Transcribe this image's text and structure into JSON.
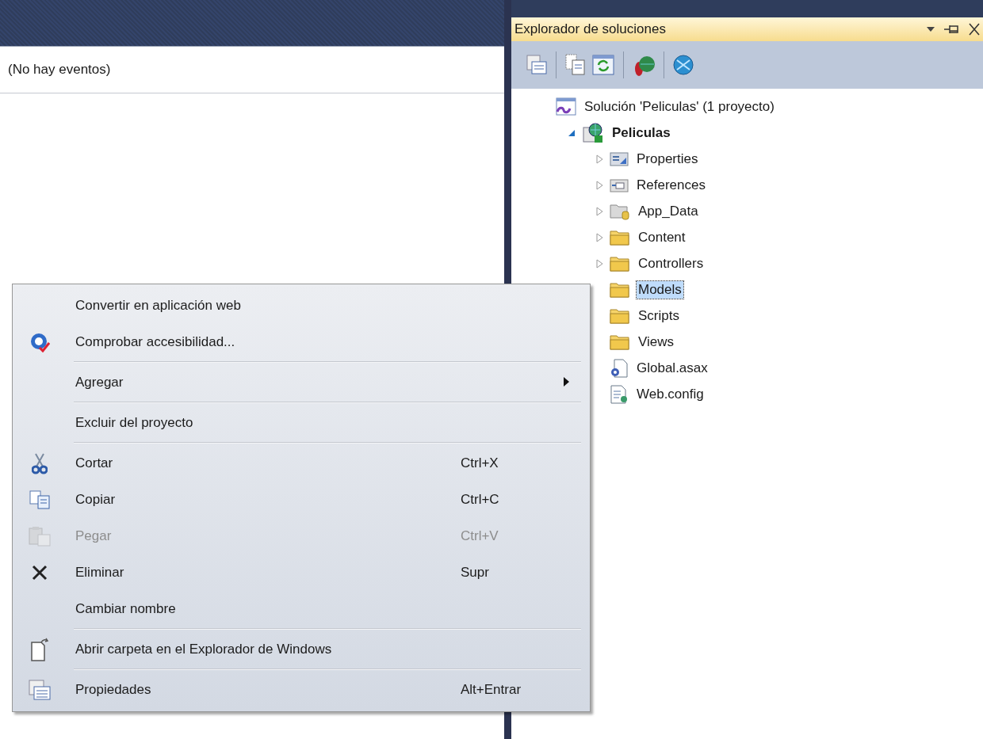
{
  "left_pane": {
    "event_dropdown": "(No hay eventos)"
  },
  "solution_explorer": {
    "title": "Explorador de soluciones",
    "tree": [
      {
        "label": "Solución 'Peliculas'  (1 proyecto)",
        "kind": "solution",
        "selected": false,
        "children": [
          {
            "label": "Peliculas",
            "kind": "project",
            "expanded": true,
            "selected": false,
            "children": [
              {
                "label": "Properties",
                "kind": "properties",
                "expanded": false,
                "selected": false
              },
              {
                "label": "References",
                "kind": "references",
                "expanded": false,
                "selected": false
              },
              {
                "label": "App_Data",
                "kind": "app-data",
                "expanded": false,
                "selected": false
              },
              {
                "label": "Content",
                "kind": "folder",
                "expanded": false,
                "selected": false
              },
              {
                "label": "Controllers",
                "kind": "folder",
                "expanded": false,
                "selected": false
              },
              {
                "label": "Models",
                "kind": "folder",
                "selected": true
              },
              {
                "label": "Scripts",
                "kind": "folder",
                "selected": false
              },
              {
                "label": "Views",
                "kind": "folder",
                "selected": false
              },
              {
                "label": "Global.asax",
                "kind": "global",
                "selected": false
              },
              {
                "label": "Web.config",
                "kind": "config",
                "selected": false
              }
            ]
          }
        ]
      }
    ]
  },
  "context_menu": [
    {
      "kind": "item",
      "label": "Convertir en aplicación web",
      "disabled": false
    },
    {
      "kind": "item",
      "label": "Comprobar accesibilidad...",
      "disabled": false
    },
    {
      "kind": "separator"
    },
    {
      "kind": "item",
      "label": "Agregar",
      "submenu": true,
      "disabled": false
    },
    {
      "kind": "separator"
    },
    {
      "kind": "item",
      "label": "Excluir del proyecto",
      "disabled": false
    },
    {
      "kind": "separator"
    },
    {
      "kind": "item",
      "label": "Cortar",
      "shortcut": "Ctrl+X",
      "disabled": false
    },
    {
      "kind": "item",
      "label": "Copiar",
      "shortcut": "Ctrl+C",
      "disabled": false
    },
    {
      "kind": "item",
      "label": "Pegar",
      "shortcut": "Ctrl+V",
      "disabled": true
    },
    {
      "kind": "item",
      "label": "Eliminar",
      "shortcut": "Supr",
      "disabled": false
    },
    {
      "kind": "item",
      "label": "Cambiar nombre",
      "disabled": false
    },
    {
      "kind": "separator"
    },
    {
      "kind": "item",
      "label": "Abrir carpeta en el Explorador de Windows",
      "disabled": false
    },
    {
      "kind": "separator"
    },
    {
      "kind": "item",
      "label": "Propiedades",
      "shortcut": "Alt+Entrar",
      "disabled": false
    }
  ]
}
